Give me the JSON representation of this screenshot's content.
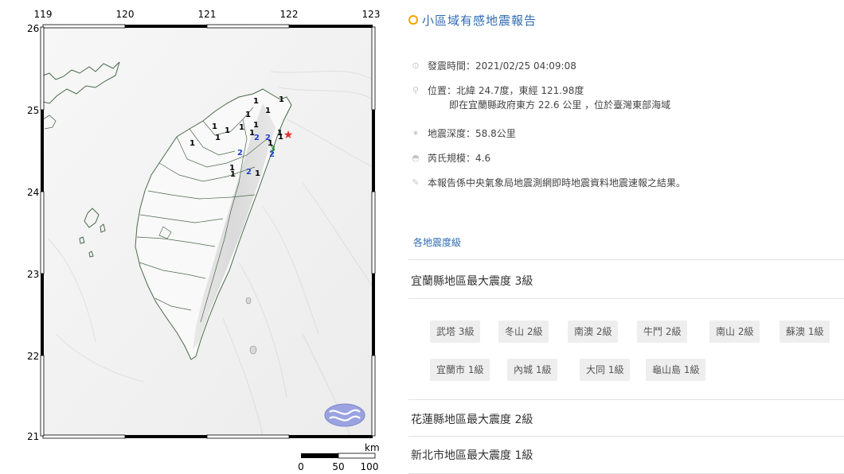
{
  "map": {
    "lon_labels": [
      "119",
      "120",
      "121",
      "122",
      "123"
    ],
    "lat_labels": [
      "26",
      "25",
      "24",
      "23",
      "22",
      "21"
    ],
    "scale": {
      "unit": "km",
      "labels": [
        "0",
        "50",
        "100"
      ]
    },
    "epicenter_symbol": "★",
    "intensity_marks": [
      {
        "t": "1",
        "c": "#000"
      },
      {
        "t": "1",
        "c": "#000"
      },
      {
        "t": "1",
        "c": "#000"
      },
      {
        "t": "1",
        "c": "#000"
      },
      {
        "t": "1",
        "c": "#000"
      },
      {
        "t": "1",
        "c": "#000"
      },
      {
        "t": "1",
        "c": "#000"
      },
      {
        "t": "1",
        "c": "#000"
      },
      {
        "t": "1",
        "c": "#000"
      },
      {
        "t": "1",
        "c": "#000"
      },
      {
        "t": "1",
        "c": "#000"
      },
      {
        "t": "1",
        "c": "#000"
      },
      {
        "t": "1",
        "c": "#000"
      },
      {
        "t": "1",
        "c": "#000"
      },
      {
        "t": "1",
        "c": "#000"
      },
      {
        "t": "1",
        "c": "#000"
      },
      {
        "t": "2",
        "c": "#2244cc"
      },
      {
        "t": "2",
        "c": "#2244cc"
      },
      {
        "t": "2",
        "c": "#2244cc"
      },
      {
        "t": "2",
        "c": "#2244cc"
      },
      {
        "t": "2",
        "c": "#2244cc"
      },
      {
        "t": "3",
        "c": "#1a8a30"
      },
      {
        "t": "1",
        "c": "#000"
      }
    ]
  },
  "report": {
    "title": "小區域有感地震報告",
    "time": "發震時間：2021/02/25 04:09:08",
    "location_line1": "位置：北緯 24.7度，東經 121.98度",
    "location_line2": "即在宜蘭縣政府東方 22.6 公里 ，位於臺灣東部海域",
    "depth": "地震深度：58.8公里",
    "magnitude": "芮氏規模：4.6",
    "note": "本報告係中央氣象局地震測網即時地震資料地震速報之結果。",
    "section_title": "各地震度級",
    "areas": [
      {
        "title": "宜蘭縣地區最大震度 3級",
        "stations": [
          "武塔 3級",
          "冬山 2級",
          "南澳 2級",
          "牛鬥 2級",
          "南山 2級",
          "蘇澳 1級",
          "宜蘭市 1級",
          "內城 1級",
          "大同 1級",
          "龜山島 1級"
        ]
      },
      {
        "title": "花蓮縣地區最大震度 2級",
        "stations": []
      },
      {
        "title": "新北市地區最大震度 1級",
        "stations": []
      }
    ]
  }
}
